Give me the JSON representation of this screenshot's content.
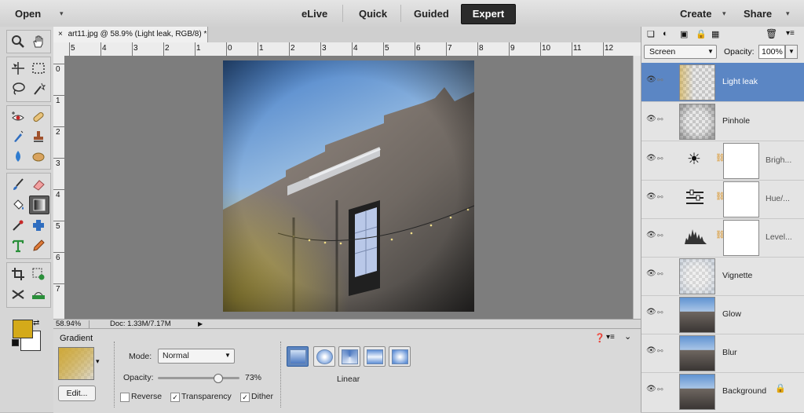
{
  "topbar": {
    "open_label": "Open",
    "modes": [
      "eLive",
      "Quick",
      "Guided",
      "Expert"
    ],
    "create_label": "Create",
    "share_label": "Share"
  },
  "document": {
    "tab_title": "art11.jpg @ 58.9% (Light leak, RGB/8) *",
    "close_glyph": "×"
  },
  "ruler": {
    "horizontal": [
      "5",
      "4",
      "3",
      "2",
      "1",
      "0",
      "1",
      "2",
      "3",
      "4",
      "5",
      "6",
      "7",
      "8",
      "9",
      "10",
      "11",
      "12"
    ],
    "vertical": [
      "0",
      "1",
      "2",
      "3",
      "4",
      "5",
      "6",
      "7"
    ]
  },
  "status": {
    "zoom": "58.94%",
    "doc_info": "Doc: 1.33M/7.17M"
  },
  "options": {
    "tool_name": "Gradient",
    "edit_label": "Edit...",
    "mode_label": "Mode:",
    "mode_value": "Normal",
    "opacity_label": "Opacity:",
    "opacity_value": "73%",
    "opacity_fraction": 0.73,
    "reverse_label": "Reverse",
    "reverse_checked": false,
    "transparency_label": "Transparency",
    "transparency_checked": true,
    "dither_label": "Dither",
    "dither_checked": true,
    "gradient_type_label": "Linear",
    "gradient_types": [
      "linear",
      "radial",
      "angle",
      "reflected",
      "diamond"
    ]
  },
  "layers": {
    "blend_mode": "Screen",
    "opacity_label": "Opacity:",
    "opacity_value": "100%",
    "items": [
      {
        "name": "Light leak",
        "selected": true,
        "type": "pixel"
      },
      {
        "name": "Pinhole",
        "selected": false,
        "type": "pixel"
      },
      {
        "name": "Brigh...",
        "selected": false,
        "type": "adjustment",
        "icon": "brightness-icon"
      },
      {
        "name": "Hue/...",
        "selected": false,
        "type": "adjustment",
        "icon": "hue-saturation-icon"
      },
      {
        "name": "Level...",
        "selected": false,
        "type": "adjustment",
        "icon": "levels-icon"
      },
      {
        "name": "Vignette",
        "selected": false,
        "type": "pixel"
      },
      {
        "name": "Glow",
        "selected": false,
        "type": "photo"
      },
      {
        "name": "Blur",
        "selected": false,
        "type": "photo"
      },
      {
        "name": "Background",
        "selected": false,
        "type": "photo",
        "locked": true
      }
    ]
  },
  "colors": {
    "foreground": "#d4aa1a",
    "background": "#ffffff",
    "selected_layer": "#5b86c4",
    "active_mode": "#2b2b2b"
  }
}
